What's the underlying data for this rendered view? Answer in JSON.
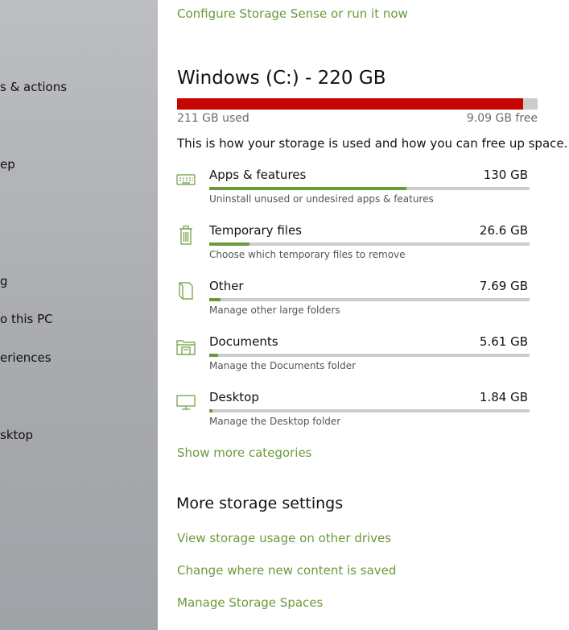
{
  "sidebar": {
    "items": [
      {
        "label": "s & actions"
      },
      {
        "label": "ep"
      },
      {
        "label": "g"
      },
      {
        "label": "o this PC"
      },
      {
        "label": "eriences"
      },
      {
        "label": "sktop"
      }
    ]
  },
  "storage_sense_link": "Configure Storage Sense or run it now",
  "drive": {
    "title": "Windows (C:) - 220 GB",
    "used_label": "211 GB used",
    "free_label": "9.09 GB free",
    "used_fraction": 0.959,
    "bar_color": "#c50500"
  },
  "intro": "This is how your storage is used and how you can free up space.",
  "categories": [
    {
      "name": "Apps & features",
      "size": "130 GB",
      "description": "Uninstall unused or undesired apps & features",
      "fraction": 0.616,
      "icon": "keyboard-icon"
    },
    {
      "name": "Temporary files",
      "size": "26.6 GB",
      "description": "Choose which temporary files to remove",
      "fraction": 0.126,
      "icon": "trash-icon"
    },
    {
      "name": "Other",
      "size": "7.69 GB",
      "description": "Manage other large folders",
      "fraction": 0.036,
      "icon": "file-icon"
    },
    {
      "name": "Documents",
      "size": "5.61 GB",
      "description": "Manage the Documents folder",
      "fraction": 0.027,
      "icon": "documents-folder-icon"
    },
    {
      "name": "Desktop",
      "size": "1.84 GB",
      "description": "Manage the Desktop folder",
      "fraction": 0.009,
      "icon": "monitor-icon"
    }
  ],
  "show_more_link": "Show more categories",
  "more_settings": {
    "title": "More storage settings",
    "links": [
      "View storage usage on other drives",
      "Change where new content is saved",
      "Manage Storage Spaces"
    ]
  },
  "colors": {
    "accent": "#6b9a3b",
    "drive_bar": "#c50500",
    "track": "#cccccc"
  }
}
